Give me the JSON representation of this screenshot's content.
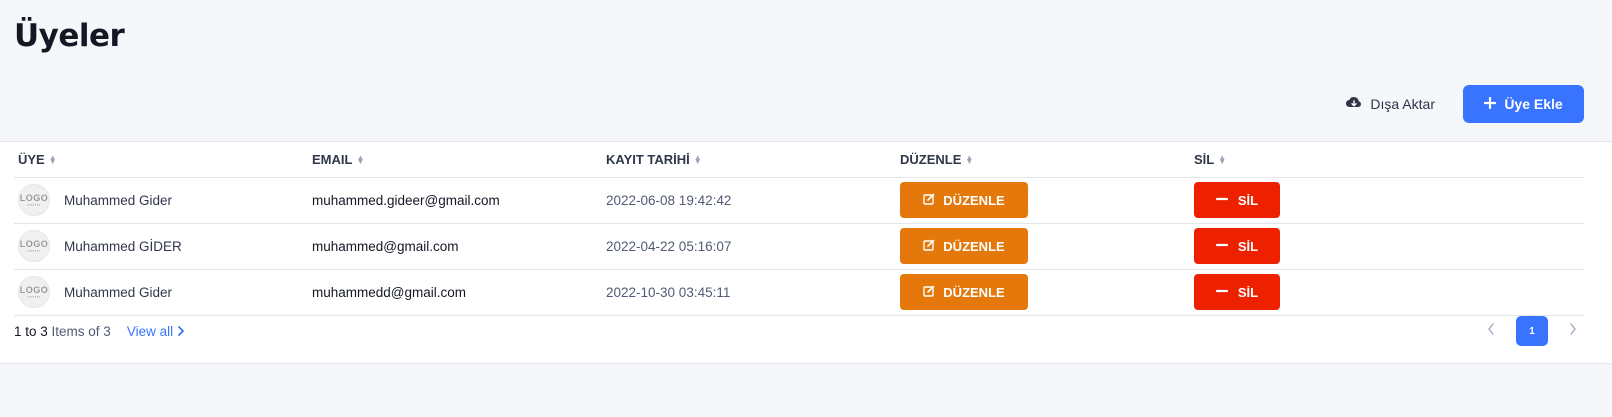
{
  "page": {
    "title": "Üyeler"
  },
  "toolbar": {
    "export_label": "Dışa Aktar",
    "add_label": "Üye Ekle"
  },
  "table": {
    "headers": {
      "user": "ÜYE",
      "email": "EMAIL",
      "date": "KAYIT TARİHİ",
      "edit": "DÜZENLE",
      "delete": "SİL"
    },
    "rows": [
      {
        "avatar": "LOGO",
        "name": "Muhammed Gider",
        "email": "muhammed.gideer@gmail.com",
        "date": "2022-06-08 19:42:42",
        "edit_label": "DÜZENLE",
        "delete_label": "SİL"
      },
      {
        "avatar": "LOGO",
        "name": "Muhammed GİDER",
        "email": "muhammed@gmail.com",
        "date": "2022-04-22 05:16:07",
        "edit_label": "DÜZENLE",
        "delete_label": "SİL"
      },
      {
        "avatar": "LOGO",
        "name": "Muhammed Gider",
        "email": "muhammedd@gmail.com",
        "date": "2022-10-30 03:45:11",
        "edit_label": "DÜZENLE",
        "delete_label": "SİL"
      }
    ]
  },
  "footer": {
    "range": "1 to 3",
    "items_text": "Items of 3",
    "view_all": "View all"
  },
  "pagination": {
    "current_page": "1"
  },
  "colors": {
    "primary": "#3874ff",
    "edit": "#e5780b",
    "delete": "#ed2000"
  },
  "icons": [
    "cloud-download-icon",
    "plus-icon",
    "sort-icon",
    "edit-icon",
    "minus-icon",
    "chevron-right-icon",
    "chevron-left-icon"
  ]
}
